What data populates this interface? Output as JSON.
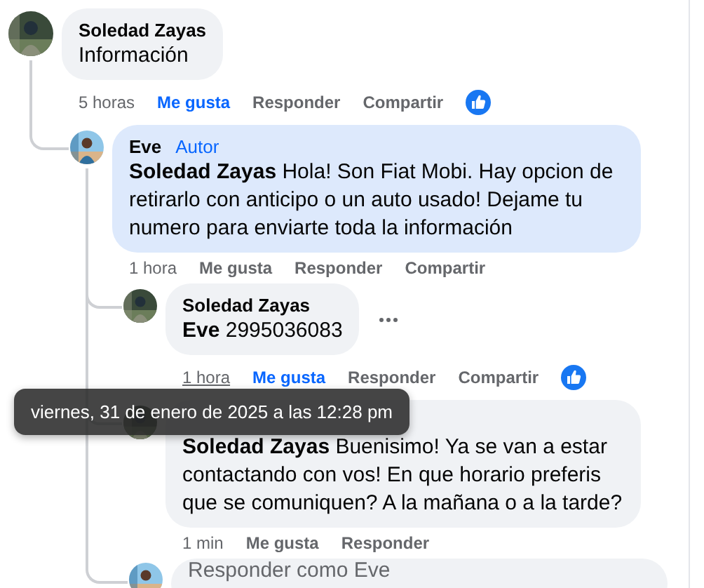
{
  "comments": [
    {
      "author": "Soledad Zayas",
      "text": "Información",
      "time": "5 horas",
      "like_label": "Me gusta",
      "reply_label": "Responder",
      "share_label": "Compartir",
      "liked": true,
      "highlighted": false,
      "time_hovered": false,
      "show_more": false,
      "reactions": true,
      "replies": [
        {
          "author": "Eve",
          "badge": "Autor",
          "text": "**Soledad Zayas** Hola! Son Fiat Mobi. Hay opcion de retirarlo con anticipo o un auto usado! Dejame tu numero para enviarte toda la información",
          "time": "1 hora",
          "like_label": "Me gusta",
          "reply_label": "Responder",
          "share_label": "Compartir",
          "liked": false,
          "highlighted": true,
          "time_hovered": false,
          "show_more": false,
          "reactions": false,
          "replies": [
            {
              "author": "Soledad Zayas",
              "text": "**Eve** 2995036083",
              "time": "1 hora",
              "like_label": "Me gusta",
              "reply_label": "Responder",
              "share_label": "Compartir",
              "liked": true,
              "highlighted": false,
              "time_hovered": true,
              "show_more": true,
              "reactions": true
            },
            {
              "text": "**Soledad Zayas** Buenisimo! Ya se van a estar contactando con vos! En que horario preferis que se comuniquen? A la mañana o a la tarde?",
              "time": "1 min",
              "like_label": "Me gusta",
              "reply_label": "Responder",
              "liked": false,
              "highlighted": false,
              "time_hovered": false,
              "show_more": false,
              "reactions": false
            }
          ],
          "reply_box": {
            "placeholder": "Responder como Eve"
          }
        }
      ]
    }
  ],
  "tooltip": {
    "text": "viernes, 31 de enero de 2025 a las 12:28 pm"
  }
}
